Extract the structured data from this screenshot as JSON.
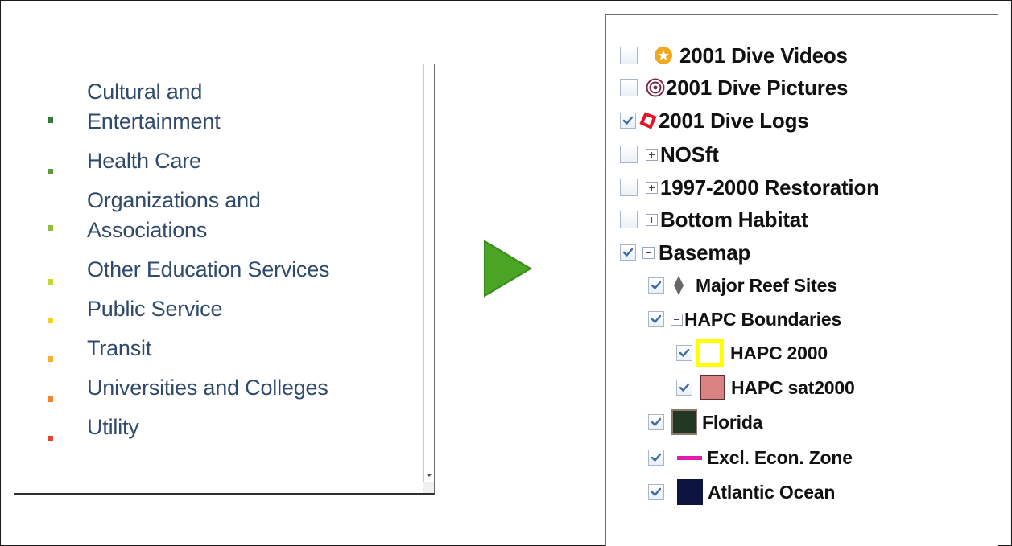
{
  "categories": [
    {
      "label_lines": [
        "Cultural and",
        "Entertainment"
      ],
      "color": "#2e7d32"
    },
    {
      "label_lines": [
        "Health Care"
      ],
      "color": "#5d9b3a"
    },
    {
      "label_lines": [
        "Organizations and",
        "Associations"
      ],
      "color": "#8fbd3c"
    },
    {
      "label_lines": [
        "Other Education Services"
      ],
      "color": "#c8d628"
    },
    {
      "label_lines": [
        "Public Service"
      ],
      "color": "#ecd41c"
    },
    {
      "label_lines": [
        "Transit"
      ],
      "color": "#f5b032"
    },
    {
      "label_lines": [
        "Universities and Colleges"
      ],
      "color": "#f5852a"
    },
    {
      "label_lines": [
        "Utility"
      ],
      "color": "#e8402a"
    }
  ],
  "arrow_color": "#4aa524",
  "layers": [
    {
      "label": "2001 Dive Videos",
      "checked": false,
      "icon": "gold-star-circle-icon"
    },
    {
      "label": "2001 Dive Pictures",
      "checked": false,
      "icon": "target-rings-icon"
    },
    {
      "label": "2001 Dive Logs",
      "checked": true,
      "icon": "red-diamond-icon"
    },
    {
      "label": "NOSft",
      "checked": false,
      "expander": "plus"
    },
    {
      "label": "1997-2000 Restoration",
      "checked": false,
      "expander": "plus"
    },
    {
      "label": "Bottom Habitat",
      "checked": false,
      "expander": "plus"
    },
    {
      "label": "Basemap",
      "checked": true,
      "expander": "minus"
    },
    {
      "label": "Major Reef Sites",
      "checked": true,
      "icon": "gray-diamond-icon"
    },
    {
      "label": "HAPC Boundaries",
      "checked": true,
      "expander": "minus"
    },
    {
      "label": "HAPC 2000",
      "checked": true,
      "icon": "yellow-outline-square-icon",
      "swatch_color": "#ffff00"
    },
    {
      "label": "HAPC sat2000",
      "checked": true,
      "icon": "pink-square-icon",
      "swatch_color": "#d98282"
    },
    {
      "label": "Florida",
      "checked": true,
      "icon": "dark-green-square-icon",
      "swatch_color": "#223822"
    },
    {
      "label": "Excl. Econ. Zone",
      "checked": true,
      "icon": "magenta-line-icon",
      "swatch_color": "#e21bb3"
    },
    {
      "label": "Atlantic Ocean",
      "checked": true,
      "icon": "navy-square-icon",
      "swatch_color": "#0c1440"
    }
  ]
}
